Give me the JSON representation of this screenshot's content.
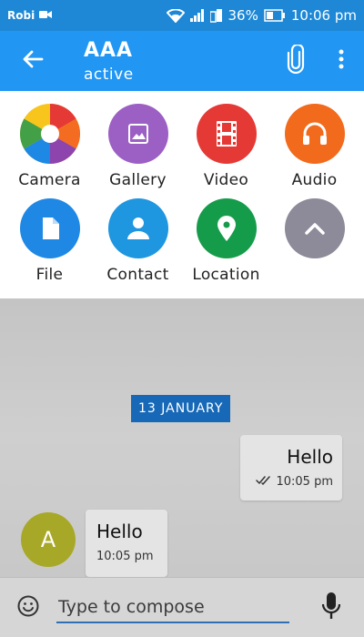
{
  "status_bar": {
    "carrier": "Robi",
    "battery_percent": "36%",
    "time": "10:06 pm"
  },
  "app_bar": {
    "title": "AAA",
    "subtitle": "active",
    "icons": [
      "back-arrow-icon",
      "paperclip-icon",
      "more-vertical-icon"
    ]
  },
  "attachments": {
    "items": [
      {
        "label": "Camera",
        "icon": "camera-aperture-icon"
      },
      {
        "label": "Gallery",
        "icon": "image-icon",
        "color": "#9c5fc4"
      },
      {
        "label": "Video",
        "icon": "film-icon",
        "color": "#e53935"
      },
      {
        "label": "Audio",
        "icon": "headphones-icon",
        "color": "#f26a1b"
      },
      {
        "label": "File",
        "icon": "file-icon",
        "color": "#1f88e5"
      },
      {
        "label": "Contact",
        "icon": "person-icon",
        "color": "#1f96e0"
      },
      {
        "label": "Location",
        "icon": "map-pin-icon",
        "color": "#159c4a"
      },
      {
        "label": "",
        "icon": "chevron-up-icon",
        "color": "#8d8a99"
      }
    ]
  },
  "chat": {
    "date_chip": "13 JANUARY",
    "messages": [
      {
        "direction": "outgoing",
        "text": "Hello",
        "time": "10:05 pm",
        "status": "double-check-icon"
      },
      {
        "direction": "incoming",
        "text": "Hello",
        "time": "10:05 pm",
        "avatar_letter": "A"
      }
    ]
  },
  "compose": {
    "placeholder": "Type to compose",
    "value": ""
  },
  "colors": {
    "app_bar": "#2196f3",
    "status_bar": "#1e88d6",
    "date_chip": "#1769b8",
    "avatar": "#a8a828"
  }
}
